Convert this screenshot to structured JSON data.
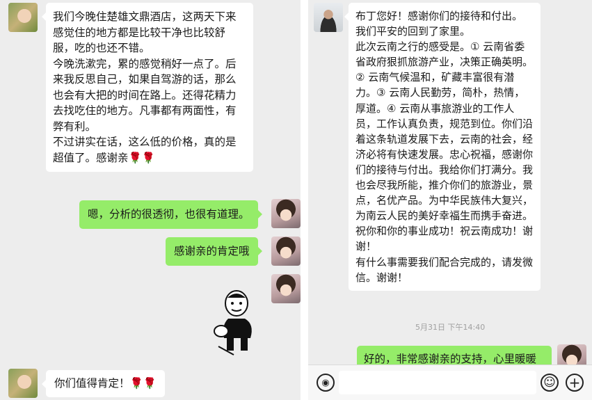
{
  "left_chat": {
    "msg1": "我们今晚住楚雄文鼎酒店，这两天下来感觉住的地方都是比较干净也比较舒服，吃的也还不错。\n今晚洗漱完，累的感觉稍好一点了。后来我反思自己，如果自驾游的话，那么也会有大把的时间在路上。还得花精力去找吃住的地方。凡事都有两面性，有弊有利。\n不过讲实在话，这么低的价格，真的是超值了。感谢亲🌹🌹",
    "reply1": "嗯，分析的很透彻，也很有道理。",
    "reply2": "感谢亲的肯定哦",
    "msg2": "你们值得肯定！🌹🌹"
  },
  "right_chat": {
    "msg1": "布丁您好！感谢你们的接待和付出。\n我们平安的回到了家里。\n此次云南之行的感受是。① 云南省委省政府狠抓旅游产业，决策正确英明。② 云南气候温和，矿藏丰富很有潜力。③ 云南人民勤劳，简朴，热情，厚道。④ 云南从事旅游业的工作人员，工作认真负责，规范到位。你们沿着这条轨道发展下去，云南的社会，经济必将有快速发展。忠心祝福，感谢你们的接待与付出。我给你们打满分。我也会尽我所能，推介你们的旅游业，景点，名优产品。为中华民族伟大复兴，为南云人民的美好幸福生而携手奋进。祝你和你的事业成功！祝云南成功！谢谢！\n有什么事需要我们配合完成的，请发微信。谢谢！",
    "timestamp": "5月31日 下午14:40",
    "reply1": "好的，非常感谢亲的支持，心里暖暖"
  },
  "icons": {
    "voice": "voice-icon",
    "emoji": "emoji-icon",
    "plus": "plus-icon",
    "voice_glyph": "◉",
    "emoji_glyph": "☺",
    "plus_glyph": "+"
  },
  "colors": {
    "chat_bg": "#ededed",
    "received_bubble": "#ffffff",
    "sent_bubble": "#95ec69"
  }
}
